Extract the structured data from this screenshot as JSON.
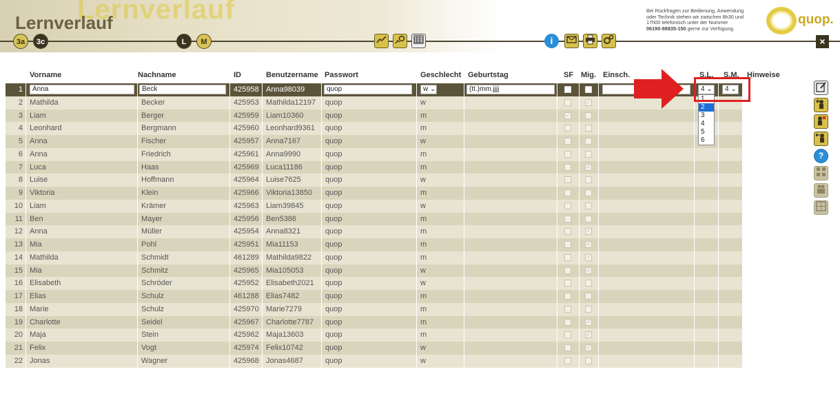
{
  "header": {
    "watermark": "Lernverlauf",
    "title": "Lernverlauf",
    "class_buttons": [
      "3a",
      "3c"
    ],
    "level_buttons": [
      "L",
      "M"
    ],
    "help_text_line1": "Bei Rückfragen zur Bedienung, Anwendung",
    "help_text_line2": "oder Technik stehen wir zwischen 8h30 und",
    "help_text_line3": "17h00 telefonisch unter der Nummer",
    "help_phone": "06190-88835-150",
    "help_text_line4": " gerne zur Verfügung.",
    "logo_text": "quop.",
    "close_label": "×"
  },
  "toolbar_icons": [
    "chart-icon",
    "settings-chart-icon",
    "calendar-table-icon",
    "info-icon",
    "mail-icon",
    "print-icon",
    "gears-icon"
  ],
  "columns": {
    "vorname": "Vorname",
    "nachname": "Nachname",
    "id": "ID",
    "benutzername": "Benutzername",
    "passwort": "Passwort",
    "geschlecht": "Geschlecht",
    "geburtstag": "Geburtstag",
    "sf": "SF",
    "mig": "Mig.",
    "einsch": "Einsch.",
    "sl": "S.L.",
    "sm": "S.M.",
    "hinweise": "Hinweise"
  },
  "selected_row": {
    "num": "1",
    "vorname": "Anna",
    "nachname": "Beck",
    "id": "425958",
    "benutzername": "Anna98039",
    "passwort": "quop",
    "geschlecht": "w",
    "geburtstag": "(tt.)mm.jjjj",
    "sl": "4",
    "sm": "4"
  },
  "rows": [
    {
      "num": "2",
      "vorname": "Mathilda",
      "nachname": "Becker",
      "id": "425953",
      "benutzername": "Mathilda12197",
      "passwort": "quop",
      "g": "w",
      "sf": false,
      "mig": true
    },
    {
      "num": "3",
      "vorname": "Liam",
      "nachname": "Berger",
      "id": "425959",
      "benutzername": "Liam10360",
      "passwort": "quop",
      "g": "m",
      "sf": true,
      "mig": false
    },
    {
      "num": "4",
      "vorname": "Leonhard",
      "nachname": "Bergmann",
      "id": "425960",
      "benutzername": "Leonhard9361",
      "passwort": "quop",
      "g": "m",
      "sf": false,
      "mig": false
    },
    {
      "num": "5",
      "vorname": "Anna",
      "nachname": "Fischer",
      "id": "425957",
      "benutzername": "Anna7167",
      "passwort": "quop",
      "g": "w",
      "sf": false,
      "mig": false
    },
    {
      "num": "6",
      "vorname": "Anna",
      "nachname": "Friedrich",
      "id": "425961",
      "benutzername": "Anna9990",
      "passwort": "quop",
      "g": "m",
      "sf": false,
      "mig": false
    },
    {
      "num": "7",
      "vorname": "Luca",
      "nachname": "Haas",
      "id": "425969",
      "benutzername": "Luca11186",
      "passwort": "quop",
      "g": "m",
      "sf": false,
      "mig": true
    },
    {
      "num": "8",
      "vorname": "Luise",
      "nachname": "Hoffmann",
      "id": "425964",
      "benutzername": "Luise7625",
      "passwort": "quop",
      "g": "w",
      "sf": false,
      "mig": false
    },
    {
      "num": "9",
      "vorname": "Viktoria",
      "nachname": "Klein",
      "id": "425966",
      "benutzername": "Viktoria13850",
      "passwort": "quop",
      "g": "m",
      "sf": false,
      "mig": false
    },
    {
      "num": "10",
      "vorname": "Liam",
      "nachname": "Krämer",
      "id": "425963",
      "benutzername": "Liam39845",
      "passwort": "quop",
      "g": "w",
      "sf": false,
      "mig": false
    },
    {
      "num": "11",
      "vorname": "Ben",
      "nachname": "Mayer",
      "id": "425956",
      "benutzername": "Ben5386",
      "passwort": "quop",
      "g": "m",
      "sf": false,
      "mig": false
    },
    {
      "num": "12",
      "vorname": "Anna",
      "nachname": "Müller",
      "id": "425954",
      "benutzername": "Anna8321",
      "passwort": "quop",
      "g": "m",
      "sf": false,
      "mig": true
    },
    {
      "num": "13",
      "vorname": "Mia",
      "nachname": "Pohl",
      "id": "425951",
      "benutzername": "Mia11153",
      "passwort": "quop",
      "g": "m",
      "sf": false,
      "mig": true
    },
    {
      "num": "14",
      "vorname": "Mathilda",
      "nachname": "Schmidt",
      "id": "461289",
      "benutzername": "Mathilda9822",
      "passwort": "quop",
      "g": "m",
      "sf": false,
      "mig": true
    },
    {
      "num": "15",
      "vorname": "Mia",
      "nachname": "Schmitz",
      "id": "425965",
      "benutzername": "Mia105053",
      "passwort": "quop",
      "g": "w",
      "sf": false,
      "mig": true
    },
    {
      "num": "16",
      "vorname": "Elisabeth",
      "nachname": "Schröder",
      "id": "425952",
      "benutzername": "Elisabeth2021",
      "passwort": "quop",
      "g": "w",
      "sf": false,
      "mig": false
    },
    {
      "num": "17",
      "vorname": "Elias",
      "nachname": "Schulz",
      "id": "461288",
      "benutzername": "Elias7482",
      "passwort": "quop",
      "g": "m",
      "sf": false,
      "mig": false
    },
    {
      "num": "18",
      "vorname": "Marie",
      "nachname": "Schulz",
      "id": "425970",
      "benutzername": "Marie7279",
      "passwort": "quop",
      "g": "m",
      "sf": false,
      "mig": false
    },
    {
      "num": "19",
      "vorname": "Charlotte",
      "nachname": "Seidel",
      "id": "425967",
      "benutzername": "Charlotte7787",
      "passwort": "quop",
      "g": "m",
      "sf": false,
      "mig": true
    },
    {
      "num": "20",
      "vorname": "Maja",
      "nachname": "Stein",
      "id": "425962",
      "benutzername": "Maja13603",
      "passwort": "quop",
      "g": "m",
      "sf": false,
      "mig": true
    },
    {
      "num": "21",
      "vorname": "Felix",
      "nachname": "Vogt",
      "id": "425974",
      "benutzername": "Felix10742",
      "passwort": "quop",
      "g": "w",
      "sf": false,
      "mig": true
    },
    {
      "num": "22",
      "vorname": "Jonas",
      "nachname": "Wagner",
      "id": "425968",
      "benutzername": "Jonas4687",
      "passwort": "quop",
      "g": "w",
      "sf": false,
      "mig": false
    }
  ],
  "dropdown_options": [
    "1",
    "2",
    "3",
    "4",
    "5",
    "6"
  ],
  "dropdown_highlight": "2",
  "side_icons": [
    "edit-list-icon",
    "add-student-icon",
    "remove-student-icon",
    "move-student-icon",
    "help-icon",
    "grid-icon",
    "group-icon",
    "group-grid-icon"
  ],
  "colors": {
    "accent": "#d9c04b",
    "dark": "#3b3520",
    "highlight_red": "#e02020",
    "selection_blue": "#1e6fd9"
  }
}
